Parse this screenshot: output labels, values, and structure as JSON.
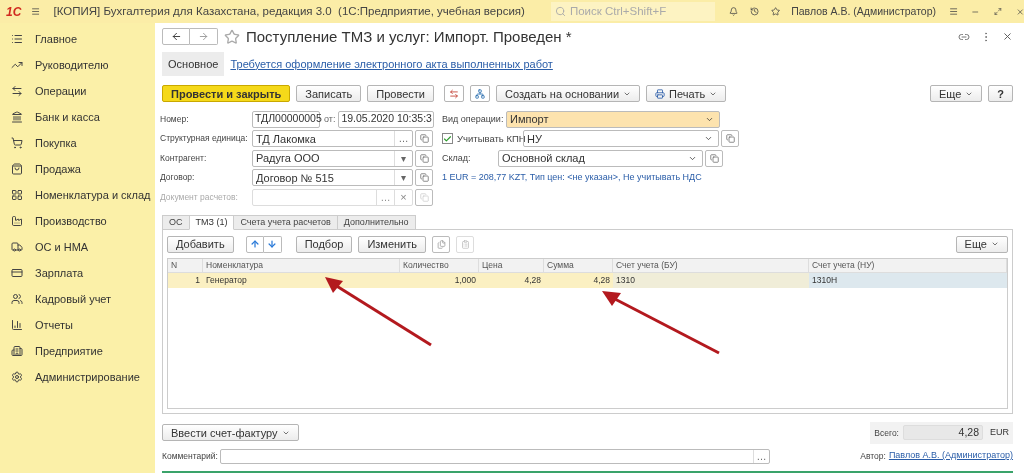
{
  "topbar": {
    "logo": "1С",
    "title": "[КОПИЯ] Бухгалтерия для Казахстана, редакция 3.0  (1С:Предприятие, учебная версия)",
    "search_placeholder": "Поиск Ctrl+Shift+F",
    "user": "Павлов А.В. (Администратор)"
  },
  "sidebar": {
    "items": [
      {
        "label": "Главное"
      },
      {
        "label": "Руководителю"
      },
      {
        "label": "Операции"
      },
      {
        "label": "Банк и касса"
      },
      {
        "label": "Покупка"
      },
      {
        "label": "Продажа"
      },
      {
        "label": "Номенклатура и склад"
      },
      {
        "label": "Производство"
      },
      {
        "label": "ОС и НМА"
      },
      {
        "label": "Зарплата"
      },
      {
        "label": "Кадровый учет"
      },
      {
        "label": "Отчеты"
      },
      {
        "label": "Предприятие"
      },
      {
        "label": "Администрирование"
      }
    ]
  },
  "document": {
    "title": "Поступление ТМЗ и услуг: Импорт. Проведен *",
    "form_tabs": [
      {
        "label": "Основное",
        "selected": true
      }
    ],
    "act_link": "Требуется оформление электронного акта выполненных работ",
    "toolbar": [
      {
        "kind": "primary",
        "label": "Провести и закрыть"
      },
      {
        "kind": "button",
        "label": "Записать"
      },
      {
        "kind": "button",
        "label": "Провести"
      },
      {
        "kind": "dtkt"
      },
      {
        "kind": "structure"
      },
      {
        "kind": "menu",
        "label": "Создать на основании"
      },
      {
        "kind": "print",
        "label": "Печать"
      }
    ],
    "more_button": "Еще",
    "help_button": "?",
    "left_fields": [
      {
        "kind": "number",
        "label": "Номер:",
        "value": "ТДЛ00000005",
        "date_label": "от:",
        "date": "19.05.2020 10:35:3",
        "disabled": false
      },
      {
        "kind": "choice",
        "label": "Структурная единица:",
        "value": "ТД Лакомка",
        "select": "…",
        "disabled": false
      },
      {
        "kind": "dropdown",
        "label": "Контрагент:",
        "value": "Радуга ООО",
        "select": "▾",
        "disabled": false
      },
      {
        "kind": "dropdown",
        "label": "Договор:",
        "value": "Договор № 515",
        "select": "▾",
        "disabled": false
      },
      {
        "kind": "choice",
        "label": "Документ расчетов:",
        "select": "…",
        "clear": "×",
        "disabled": true
      }
    ],
    "operation": {
      "label": "Вид операции:",
      "value": "Импорт"
    },
    "kpn": {
      "label": "Учитывать КПН",
      "checked": true,
      "value": "НУ"
    },
    "warehouse": {
      "label": "Склад:",
      "value": "Основной склад"
    },
    "currency_link": "1 EUR = 208,77 KZT, Тип цен: <не указан>, Не учитывать НДС",
    "tabs": [
      {
        "label": "ОС",
        "selected": false
      },
      {
        "label": "ТМЗ (1)",
        "selected": true
      },
      {
        "label": "Счета учета расчетов",
        "selected": false
      },
      {
        "label": "Дополнительно",
        "selected": false
      }
    ],
    "table_toolbar": [
      "Добавить",
      "Подбор",
      "Изменить"
    ],
    "table_more": "Еще",
    "table": {
      "columns": [
        "N",
        "Номенклатура",
        "Количество",
        "Цена",
        "Сумма",
        "Счет учета (БУ)",
        "Счет учета (НУ)"
      ],
      "rows": [
        {
          "selected": true,
          "cells": [
            "1",
            "Генератор",
            "1,000",
            "4,28",
            "4,28",
            "1310",
            "1310Н"
          ]
        }
      ]
    },
    "invoice_button": "Ввести счет-фактуру",
    "total_label": "Всего:",
    "total": "4,28",
    "total_currency": "EUR",
    "comment_label": "Комментарий:",
    "comment_select": "…",
    "author_label": "Автор:",
    "author": "Павлов А.В. (Администратор)"
  }
}
